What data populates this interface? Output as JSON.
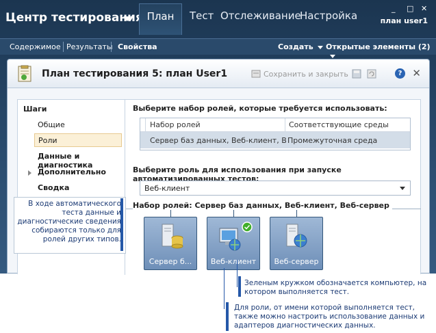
{
  "app": {
    "title": "Центр тестирования",
    "tabs": [
      "План",
      "Тест",
      "Отслеживание",
      "Настройка"
    ],
    "active_tab": "План",
    "user": "план user1",
    "window_controls": [
      "_",
      "□",
      "✕"
    ]
  },
  "subnav": {
    "links": [
      "Содержимое",
      "Результаты",
      "Свойства"
    ],
    "active": "Свойства",
    "create": "Создать",
    "open_items": "Открытые элементы (2)"
  },
  "dialog": {
    "title": "План тестирования 5: план User1",
    "save_close": "Сохранить и закрыть",
    "help": "?",
    "close": "✕"
  },
  "steps": {
    "header": "Шаги",
    "items": [
      {
        "label": "Общие",
        "selected": false,
        "bold": false
      },
      {
        "label": "Роли",
        "selected": true,
        "bold": false
      },
      {
        "label": "Данные и диагностика",
        "selected": false,
        "bold": true
      },
      {
        "label": "Дополнительно",
        "selected": false,
        "bold": true
      },
      {
        "label": "Сводка",
        "selected": false,
        "bold": true
      }
    ]
  },
  "roles": {
    "select_label": "Выберите набор ролей, которые требуется использовать:",
    "columns": [
      "Набор ролей",
      "Соответствующие среды"
    ],
    "rows": [
      [
        "Сервер баз данных, Веб-клиент, Веб-сервер",
        "Промежуточная среда"
      ]
    ],
    "role_label": "Выберите роль для использования при запуске автоматизированных тестов:",
    "role_value": "Веб-клиент",
    "set_label": "Набор ролей: Сервер баз данных, Веб-клиент, Веб-сервер",
    "machines": [
      "Сервер б...",
      "Веб-клиент",
      "Веб-сервер"
    ]
  },
  "callouts": {
    "left": "В ходе автоматического теста данные и диагностические сведения собираются только для ролей других типов.",
    "green": "Зеленым кружком обозначается компьютер, на котором выполняется тест.",
    "role": "Для роли, от имени которой выполняется тест, также можно настроить использование данных и адаптеров диагностических данных."
  },
  "colors": {
    "accent": "#2558a8",
    "header_bg": "#1b3550",
    "selection": "#fbf0d7",
    "status_ok": "#3fae2a"
  }
}
